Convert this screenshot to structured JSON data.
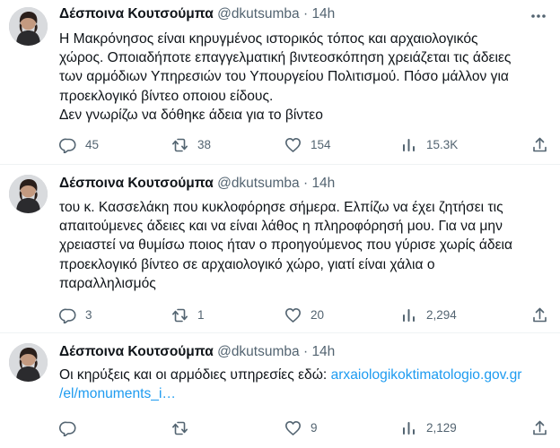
{
  "tweets": [
    {
      "author": {
        "display_name": "Δέσποινα Κουτσούμπα",
        "handle": "@dkutsumba",
        "separator": "·",
        "time": "14h"
      },
      "text_lines": [
        "Η Μακρόνησος είναι κηρυγμένος ιστορικός τόπος και αρχαιολογικός",
        "χώρος. Οποιαδήποτε επαγγελματική βιντεοσκόπηση χρειάζεται τις άδειες",
        "των αρμόδιων Υπηρεσιών του Υπουργείου Πολιτισμού. Πόσο μάλλον για",
        "προεκλογικό βίντεο οποιου είδους.",
        "Δεν γνωρίζω να δόθηκε άδεια για το βίντεο"
      ],
      "stats": {
        "replies": "45",
        "retweets": "38",
        "likes": "154",
        "views": "15.3K"
      }
    },
    {
      "author": {
        "display_name": "Δέσποινα Κουτσούμπα",
        "handle": "@dkutsumba",
        "separator": "·",
        "time": "14h"
      },
      "text_lines": [
        "του κ. Κασσελάκη που κυκλοφόρησε σήμερα. Ελπίζω να έχει ζητήσει τις",
        "απαιτούμενες άδειες και να είναι λάθος η πληροφόρησή μου. Για να μην",
        "χρειαστεί να θυμίσω ποιος ήταν ο προηγούμενος που γύρισε χωρίς άδεια",
        "προεκλογικό βίντεο σε αρχαιολογικό χώρο, γιατί είναι χάλια ο",
        "παραλληλισμός"
      ],
      "stats": {
        "replies": "3",
        "retweets": "1",
        "likes": "20",
        "views": "2,294"
      }
    },
    {
      "author": {
        "display_name": "Δέσποινα Κουτσούμπα",
        "handle": "@dkutsumba",
        "separator": "·",
        "time": "14h"
      },
      "text_prefix": "Οι κηρύξεις και οι αρμόδιες υπηρεσίες εδώ: ",
      "link_line_1": "arxaiologikoktimatologio.gov.gr",
      "link_line_2": "/el/monuments_i…",
      "stats": {
        "replies": "",
        "retweets": "",
        "likes": "9",
        "views": "2,129"
      }
    }
  ],
  "icons": {
    "reply": "reply-icon",
    "retweet": "retweet-icon",
    "like": "like-icon",
    "views": "views-icon",
    "share": "share-icon",
    "more": "more-icon",
    "avatar": "avatar"
  },
  "colors": {
    "text": "#0f1419",
    "secondary": "#536471",
    "link": "#1d9bf0",
    "divider": "#eff3f4"
  }
}
